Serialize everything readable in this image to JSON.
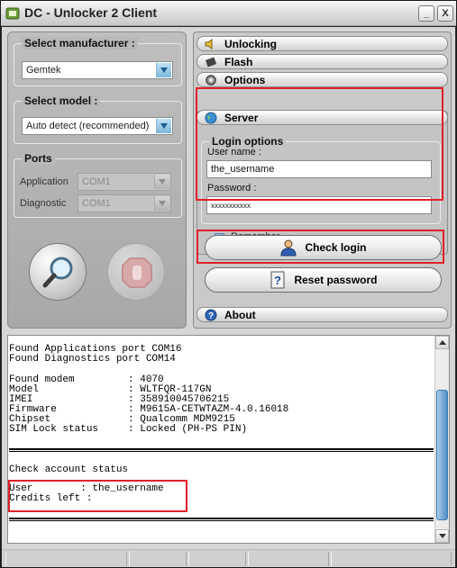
{
  "window": {
    "title": "DC - Unlocker 2 Client",
    "minimize_glyph": "_",
    "close_glyph": "X"
  },
  "manufacturer": {
    "title": "Select manufacturer :",
    "selected": "Gemtek"
  },
  "model": {
    "title": "Select model :",
    "selected": "Auto detect (recommended)"
  },
  "ports": {
    "title": "Ports",
    "application_label": "Application",
    "application_value": "COM1",
    "diagnostic_label": "Diagnostic",
    "diagnostic_value": "COM1"
  },
  "menu": {
    "unlocking": "Unlocking",
    "flash": "Flash",
    "options": "Options",
    "server": "Server",
    "about": "About"
  },
  "login": {
    "title": "Login options",
    "username_label": "User name :",
    "username_value": "the_username",
    "password_label": "Password :",
    "password_value": "xxxxxxxxxxx",
    "remember_label": "Remember"
  },
  "buttons": {
    "check_login": "Check login",
    "reset_password": "Reset password"
  },
  "log": {
    "ports": "Found Applications port COM16\nFound Diagnostics port COM14",
    "modem": "Found modem         : 4070\nModel               : WLTFQR-117GN\nIMEI                : 358910045706215\nFirmware            : M9615A-CETWTAZM-4.0.16018\nChipset             : Qualcomm MDM9215\nSIM Lock status     : Locked (PH-PS PIN)",
    "account_header": "Check account status",
    "account": "User        : the_username\nCredits left :"
  },
  "colors": {
    "highlight": "#e0202a",
    "accent_blue": "#1e5b8a"
  }
}
